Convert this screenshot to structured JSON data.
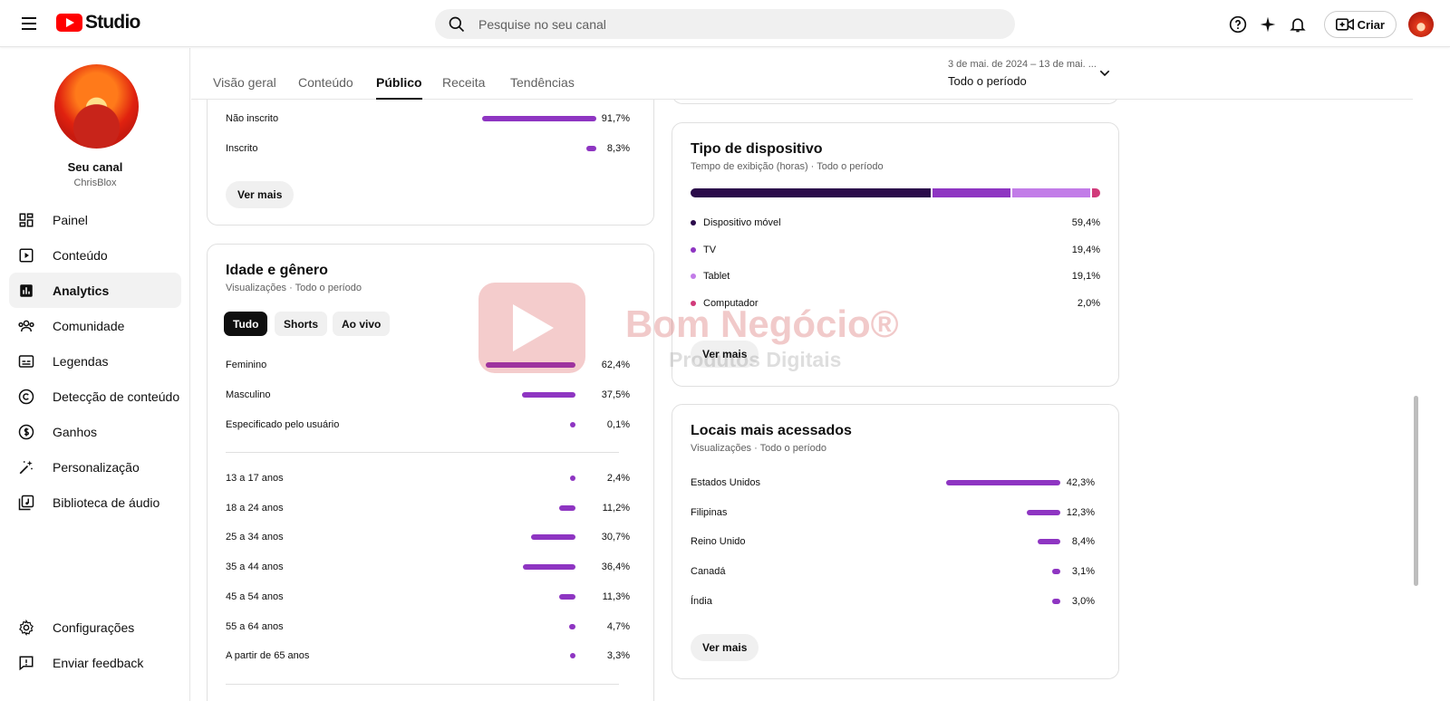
{
  "topbar": {
    "logo_text": "Studio",
    "search_placeholder": "Pesquise no seu canal",
    "create_label": "Criar"
  },
  "sidebar": {
    "channel_name": "Seu canal",
    "channel_handle": "ChrisBlox",
    "items": [
      {
        "label": "Painel",
        "icon": "dashboard-icon"
      },
      {
        "label": "Conteúdo",
        "icon": "content-icon"
      },
      {
        "label": "Analytics",
        "icon": "analytics-icon",
        "active": true
      },
      {
        "label": "Comunidade",
        "icon": "community-icon"
      },
      {
        "label": "Legendas",
        "icon": "subtitles-icon"
      },
      {
        "label": "Detecção de conteúdo",
        "icon": "copyright-icon"
      },
      {
        "label": "Ganhos",
        "icon": "earn-icon"
      },
      {
        "label": "Personalização",
        "icon": "customization-icon"
      },
      {
        "label": "Biblioteca de áudio",
        "icon": "audio-library-icon"
      }
    ],
    "bottom_items": [
      {
        "label": "Configurações",
        "icon": "settings-icon"
      },
      {
        "label": "Enviar feedback",
        "icon": "feedback-icon"
      }
    ]
  },
  "tabs": [
    {
      "label": "Visão geral"
    },
    {
      "label": "Conteúdo"
    },
    {
      "label": "Público",
      "active": true
    },
    {
      "label": "Receita"
    },
    {
      "label": "Tendências"
    }
  ],
  "period": {
    "range": "3 de mai. de 2024 – 13 de mai. ...",
    "label": "Todo o período"
  },
  "subscribers_card": {
    "rows": [
      {
        "label": "Não inscrito",
        "value": "91,7%",
        "pct": 91.7
      },
      {
        "label": "Inscrito",
        "value": "8,3%",
        "pct": 8.3
      }
    ],
    "more_label": "Ver mais"
  },
  "age_gender_card": {
    "title": "Idade e gênero",
    "subtitle": "Visualizações · Todo o período",
    "chips": [
      {
        "label": "Tudo",
        "active": true
      },
      {
        "label": "Shorts"
      },
      {
        "label": "Ao vivo"
      }
    ],
    "gender": [
      {
        "label": "Feminino",
        "value": "62,4%",
        "pct": 62.4
      },
      {
        "label": "Masculino",
        "value": "37,5%",
        "pct": 37.5
      },
      {
        "label": "Especificado pelo usuário",
        "value": "0,1%",
        "pct": 0.1
      }
    ],
    "age": [
      {
        "label": "13 a 17 anos",
        "value": "2,4%",
        "pct": 2.4
      },
      {
        "label": "18 a 24 anos",
        "value": "11,2%",
        "pct": 11.2
      },
      {
        "label": "25 a 34 anos",
        "value": "30,7%",
        "pct": 30.7
      },
      {
        "label": "35 a 44 anos",
        "value": "36,4%",
        "pct": 36.4
      },
      {
        "label": "45 a 54 anos",
        "value": "11,3%",
        "pct": 11.3
      },
      {
        "label": "55 a 64 anos",
        "value": "4,7%",
        "pct": 4.7
      },
      {
        "label": "A partir de 65 anos",
        "value": "3,3%",
        "pct": 3.3
      }
    ]
  },
  "device_card": {
    "title": "Tipo de dispositivo",
    "subtitle": "Tempo de exibição (horas) · Todo o período",
    "items": [
      {
        "label": "Dispositivo móvel",
        "value": "59,4%",
        "pct": 59.4,
        "color": "#2a0b4a"
      },
      {
        "label": "TV",
        "value": "19,4%",
        "pct": 19.4,
        "color": "#8e35c2"
      },
      {
        "label": "Tablet",
        "value": "19,1%",
        "pct": 19.1,
        "color": "#c27ce8"
      },
      {
        "label": "Computador",
        "value": "2,0%",
        "pct": 2.0,
        "color": "#d13a7a"
      }
    ],
    "more_label": "Ver mais"
  },
  "locations_card": {
    "title": "Locais mais acessados",
    "subtitle": "Visualizações · Todo o período",
    "rows": [
      {
        "label": "Estados Unidos",
        "value": "42,3%",
        "pct": 42.3
      },
      {
        "label": "Filipinas",
        "value": "12,3%",
        "pct": 12.3
      },
      {
        "label": "Reino Unido",
        "value": "8,4%",
        "pct": 8.4
      },
      {
        "label": "Canadá",
        "value": "3,1%",
        "pct": 3.1
      },
      {
        "label": "Índia",
        "value": "3,0%",
        "pct": 3.0
      }
    ],
    "more_label": "Ver mais"
  },
  "watermark": {
    "line1": "Bom Negócio®",
    "line2": "Produtos Digitais"
  },
  "colors": {
    "bar": "#8e35c2",
    "brand": "#ff0000"
  }
}
